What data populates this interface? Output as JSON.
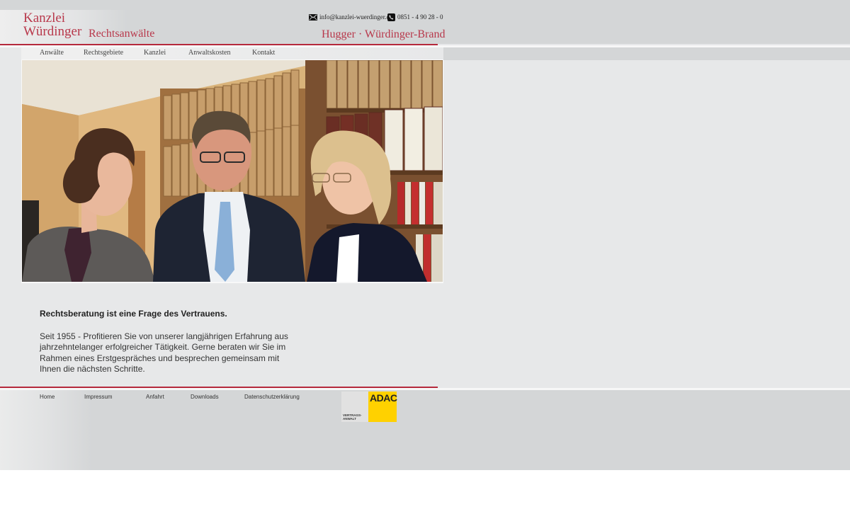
{
  "header": {
    "logo_line1": "Kanzlei",
    "logo_line2": "Würdinger",
    "logo_sub": "Rechtsanwälte",
    "email": "info@kanzlei-wuerdinger.de",
    "phone": "0851 - 4 90 28 - 0",
    "partners": "Hugger · Würdinger-Brand",
    "mail_icon": "envelope-icon",
    "phone_icon": "phone-icon"
  },
  "nav": {
    "items": [
      {
        "label": "Anwälte"
      },
      {
        "label": "Rechtsgebiete"
      },
      {
        "label": "Kanzlei"
      },
      {
        "label": "Anwaltskosten"
      },
      {
        "label": "Kontakt"
      }
    ]
  },
  "main": {
    "headline": "Rechtsberatung ist eine Frage des Vertrauens.",
    "body": "Seit 1955 - Profitieren Sie von unserer langjährigen Erfahrung aus jahrzehntelanger erfolgreicher Tätigkeit. Gerne beraten wir Sie im Rahmen eines Erstgespräches und besprechen gemeinsam mit Ihnen die nächsten Schritte."
  },
  "footer": {
    "items": [
      {
        "label": "Home"
      },
      {
        "label": "Impressum"
      },
      {
        "label": "Anfahrt"
      },
      {
        "label": "Downloads"
      },
      {
        "label": "Datenschutzerklärung"
      }
    ],
    "badge_word": "ADAC",
    "badge_sub": "VERTRAGS-ANWALT"
  },
  "colors": {
    "brand_red": "#b8384b",
    "adac_yellow": "#ffd100"
  }
}
